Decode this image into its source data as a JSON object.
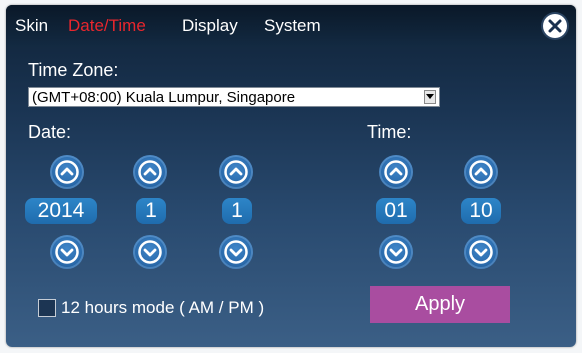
{
  "tabs": [
    {
      "label": "Skin",
      "active": false
    },
    {
      "label": "Date/Time",
      "active": true
    },
    {
      "label": "Display",
      "active": false
    },
    {
      "label": "System",
      "active": false
    }
  ],
  "colors": {
    "active_tab": "#e8262d",
    "apply_button": "#a94da0"
  },
  "time_zone": {
    "label": "Time Zone:",
    "value": "(GMT+08:00) Kuala Lumpur, Singapore"
  },
  "date": {
    "label": "Date:",
    "year": "2014",
    "month": "1",
    "day": "1"
  },
  "time": {
    "label": "Time:",
    "hour": "01",
    "minute": "10"
  },
  "options": {
    "twelve_hour_label": "12 hours mode ( AM / PM )",
    "twelve_hour_checked": false
  },
  "apply_label": "Apply",
  "icons": [
    "close-icon",
    "chevron-up-icon",
    "chevron-down-icon",
    "dropdown-arrow-icon"
  ]
}
